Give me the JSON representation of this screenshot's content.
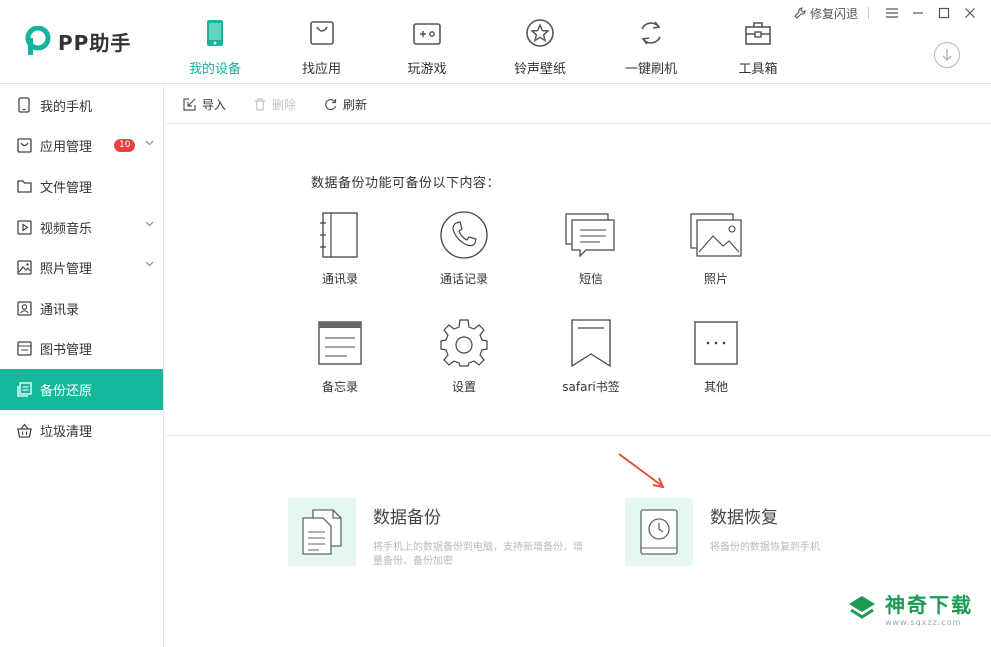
{
  "app": {
    "logo_text": "PP助手",
    "brand_color": "#11b59a",
    "accent_green": "#17b79c"
  },
  "nav": {
    "tabs": [
      {
        "label": "我的设备",
        "icon": "phone-icon",
        "active": true
      },
      {
        "label": "找应用",
        "icon": "app-bag-icon"
      },
      {
        "label": "玩游戏",
        "icon": "gamepad-icon"
      },
      {
        "label": "铃声壁纸",
        "icon": "star-icon"
      },
      {
        "label": "一键刷机",
        "icon": "refresh-cycle-icon"
      },
      {
        "label": "工具箱",
        "icon": "toolbox-icon"
      }
    ]
  },
  "window": {
    "repair_label": "修复闪退"
  },
  "sidebar": {
    "items": [
      {
        "label": "我的手机",
        "icon": "phone-icon"
      },
      {
        "label": "应用管理",
        "icon": "app-manage-icon",
        "badge": "10",
        "expandable": true
      },
      {
        "label": "文件管理",
        "icon": "folder-icon"
      },
      {
        "label": "视频音乐",
        "icon": "video-music-icon",
        "expandable": true
      },
      {
        "label": "照片管理",
        "icon": "photo-icon",
        "expandable": true
      },
      {
        "label": "通讯录",
        "icon": "contacts-icon"
      },
      {
        "label": "图书管理",
        "icon": "book-icon"
      },
      {
        "label": "备份还原",
        "icon": "backup-icon",
        "active": true
      },
      {
        "label": "垃圾清理",
        "icon": "trash-basket-icon"
      }
    ]
  },
  "toolbar": {
    "import_label": "导入",
    "delete_label": "删除",
    "refresh_label": "刷新"
  },
  "backup": {
    "heading": "数据备份功能可备份以下内容：",
    "items": [
      {
        "label": "通讯录",
        "icon": "contacts-book-icon"
      },
      {
        "label": "通话记录",
        "icon": "phone-call-icon"
      },
      {
        "label": "短信",
        "icon": "messages-icon"
      },
      {
        "label": "照片",
        "icon": "photos-icon"
      },
      {
        "label": "备忘录",
        "icon": "notes-icon"
      },
      {
        "label": "设置",
        "icon": "settings-gear-icon"
      },
      {
        "label": "safari书签",
        "icon": "bookmark-icon"
      },
      {
        "label": "其他",
        "icon": "more-icon"
      }
    ]
  },
  "actions": {
    "backup": {
      "title": "数据备份",
      "desc": "将手机上的数据备份到电脑，支持新增备份，增量备份、备份加密"
    },
    "restore": {
      "title": "数据恢复",
      "desc": "将备份的数据恢复到手机"
    }
  },
  "watermark": {
    "title": "神奇下载",
    "url": "www.sqxzz.com"
  }
}
